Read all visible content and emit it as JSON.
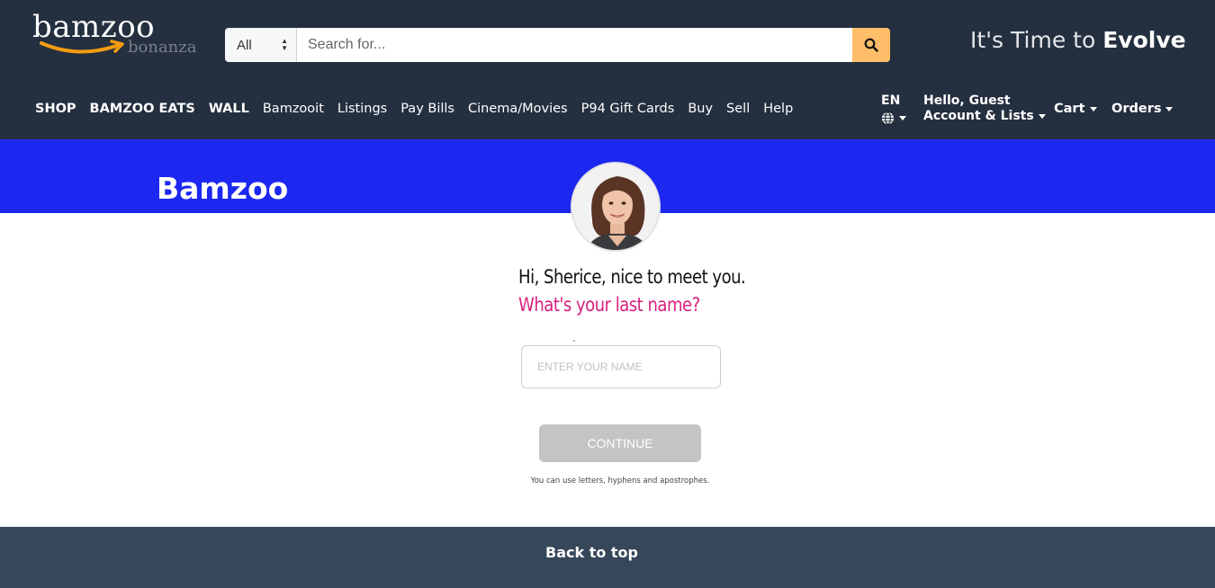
{
  "header": {
    "logo": {
      "main": "bamzoo",
      "sub": "bonanza"
    },
    "search": {
      "category": "All",
      "placeholder": "Search for..."
    },
    "tagline": {
      "prefix": "It's Time to ",
      "emphasis": "Evolve"
    },
    "nav": [
      "SHOP",
      "BAMZOO EATS",
      "WALL",
      "Bamzooit",
      "Listings",
      "Pay Bills",
      "Cinema/Movies",
      "P94 Gift Cards",
      "Buy",
      "Sell",
      "Help"
    ],
    "language": "EN",
    "account": {
      "greeting": "Hello, Guest",
      "label": "Account & Lists"
    },
    "cart": "Cart",
    "orders": "Orders"
  },
  "banner": {
    "title": "Bamzoo"
  },
  "form": {
    "greeting": "Hi, Sherice, nice to meet you.",
    "question": "What's your last name?",
    "input_placeholder": "ENTER YOUR NAME",
    "continue_label": "CONTINUE",
    "hint": "You can use letters, hyphens and apostrophes."
  },
  "footer": {
    "back_to_top": "Back to top"
  },
  "colors": {
    "header_bg": "#242f3f",
    "banner_bg": "#1c28f0",
    "search_button": "#febd69",
    "question_accent": "#d6207e",
    "continue_disabled": "#c4c4c4",
    "footer_bg": "#37475a"
  },
  "icons": {
    "search": "search-icon",
    "globe": "globe-icon",
    "logo_arrow": "smile-arrow-icon"
  }
}
